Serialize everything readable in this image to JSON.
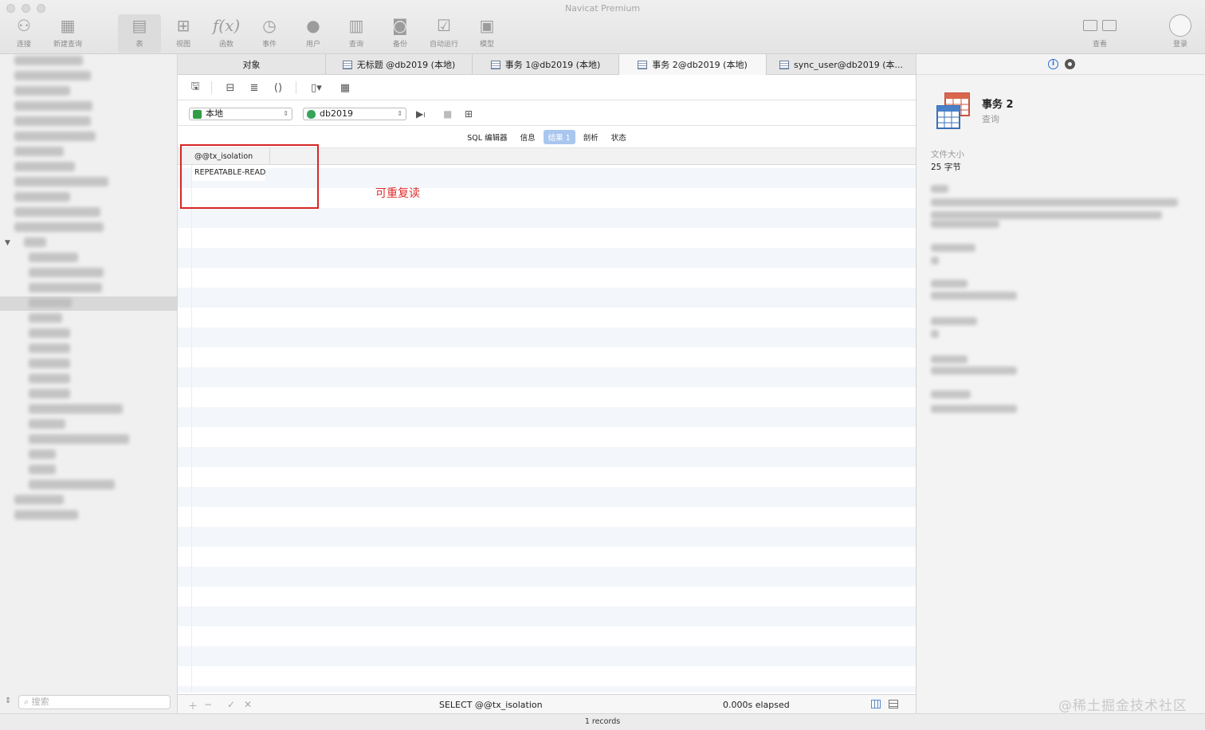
{
  "window": {
    "title": "Navicat Premium"
  },
  "toolbar": {
    "items": [
      {
        "label": "连接",
        "icon": "plug-icon"
      },
      {
        "label": "新建查询",
        "icon": "new-query-icon"
      },
      {
        "label": "表",
        "icon": "table-icon"
      },
      {
        "label": "视图",
        "icon": "view-icon"
      },
      {
        "label": "函数",
        "icon": "function-icon"
      },
      {
        "label": "事件",
        "icon": "clock-icon"
      },
      {
        "label": "用户",
        "icon": "user-icon"
      },
      {
        "label": "查询",
        "icon": "query-icon"
      },
      {
        "label": "备份",
        "icon": "backup-icon"
      },
      {
        "label": "自动运行",
        "icon": "autorun-icon"
      },
      {
        "label": "模型",
        "icon": "model-icon"
      }
    ],
    "right": [
      {
        "label": "查看",
        "icon": "view-toggle-icon"
      },
      {
        "label": "登录",
        "icon": "avatar-icon"
      }
    ]
  },
  "tabs": [
    {
      "label": "对象"
    },
    {
      "label": "无标题 @db2019 (本地)"
    },
    {
      "label": "事务 1@db2019 (本地)"
    },
    {
      "label": "事务 2@db2019 (本地)"
    },
    {
      "label": "sync_user@db2019 (本..."
    }
  ],
  "connection": {
    "name": "本地",
    "database": "db2019"
  },
  "subtabs": [
    "SQL 编辑器",
    "信息",
    "结果 1",
    "剖析",
    "状态"
  ],
  "result": {
    "columns": [
      "@@tx_isolation"
    ],
    "rows": [
      [
        "REPEATABLE-READ"
      ]
    ]
  },
  "annotation": "可重复读",
  "footer": {
    "sql": "SELECT @@tx_isolation",
    "elapsed": "0.000s elapsed"
  },
  "status": {
    "records": "1 records"
  },
  "sidebar": {
    "search_placeholder": "搜索"
  },
  "details": {
    "name": "事务 2",
    "type": "查询",
    "size_label": "文件大小",
    "size_value": "25 字节"
  },
  "watermark": "@稀土掘金技术社区",
  "colors": {
    "accent": "#2a6bd6",
    "annotation": "#e02c2c",
    "selected_subtab": "#a8c6ee"
  }
}
